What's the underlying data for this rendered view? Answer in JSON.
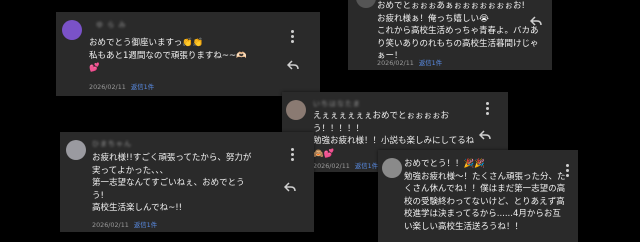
{
  "comments": [
    {
      "username": "ゆ ら み",
      "avatar_color": "#7a52c8",
      "text": "おめでとう御座いますっ👏👏\n私もあと1週間なので頑張りますね~~🫶🏻\n💕",
      "date": "2026/02/11",
      "reply_label": "返信1件"
    },
    {
      "username": "",
      "avatar_color": "#555555",
      "text": "おめでとぉぉぉあぁぉぉぉぉぉぉぉお!\nお疲れ様ぁ！俺っち嬉しい😭\nこれから高校生活めっちゃ青春よ。バカあ\nり笑いありのれもちの高校生活暮間けじゃ\nぁー！",
      "date": "2026/02/11",
      "reply_label": "返信1件"
    },
    {
      "username": "いちはなたま",
      "avatar_color": "#8a7a72",
      "text": "えぇぇぇぇぇぇおめでとぉぉぉぉお\nう！！！！！\n勉強お疲れ様！！小説も楽しみにしてるね\n🙈💕",
      "date": "2026/02/11",
      "reply_label": "返信1件"
    },
    {
      "username": "ひまちゃん",
      "avatar_color": "#9a9aa0",
      "text": "お疲れ様!!すごく頑張ってたから、努力が\n実ってよかった、、、\n第一志望なんてすごいねぇ、おめでとう\nう!\n高校生活楽しんでね~!!",
      "date": "2026/02/11",
      "reply_label": "返信1件"
    },
    {
      "username": "",
      "avatar_color": "#8a8a8a",
      "text": "おめでとう！！🎉🎉\n勉強お疲れ様〜！たくさん頑張った分、た\nくさん休んでね！！僕はまだ第一志望の高\n校の受験終わってないけど、とりあえず高\n校進学は決まってるから......4月からお互\nい楽しい高校生活送ろうね！！",
      "date": "",
      "reply_label": ""
    }
  ],
  "icons": {
    "menu": "more-vert-icon",
    "reply": "reply-icon"
  }
}
